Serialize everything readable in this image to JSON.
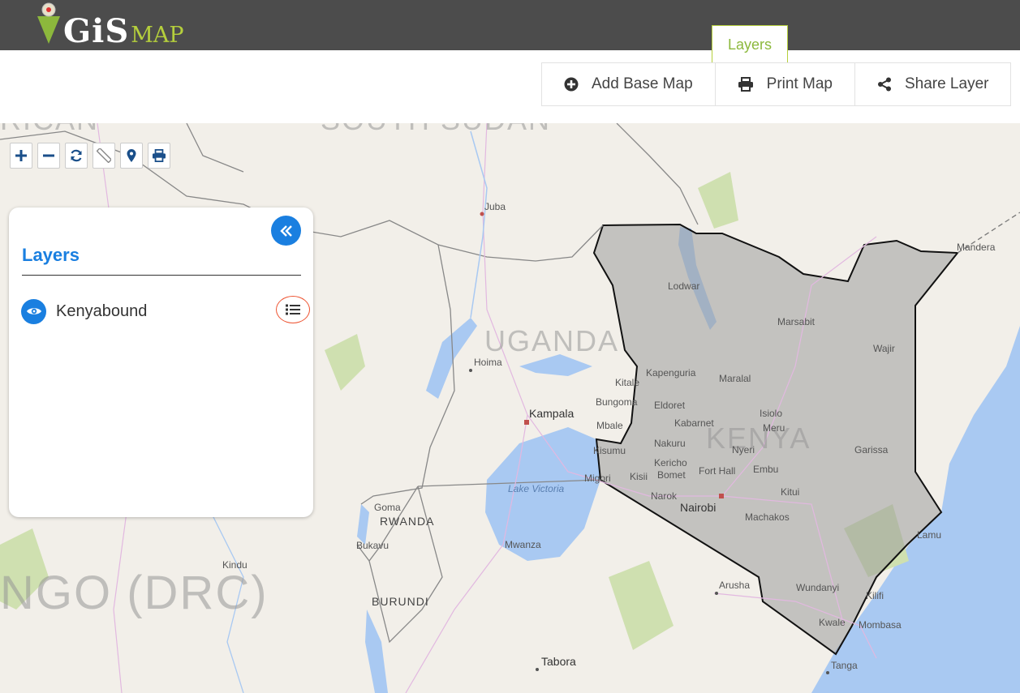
{
  "app": {
    "logo_gis": "GiS",
    "logo_map": "MAP"
  },
  "header": {
    "active_tab": "Layers"
  },
  "toolbar": {
    "add_base_map": "Add Base Map",
    "print_map": "Print Map",
    "share_layer": "Share Layer"
  },
  "map_controls": [
    "plus-icon",
    "minus-icon",
    "refresh-icon",
    "ruler-icon",
    "map-marker-icon",
    "print-icon"
  ],
  "layers_panel": {
    "title": "Layers",
    "items": [
      {
        "name": "Kenyabound",
        "visible": true
      }
    ]
  },
  "map": {
    "countries": {
      "uganda": "UGANDA",
      "kenya": "KENYA",
      "rwanda": "RWANDA",
      "burundi": "BURUNDI",
      "drc": "NGO (DRC)",
      "south_sudan": "SOUTH SUDAN",
      "car": "RICAN"
    },
    "cities": {
      "juba": "Juba",
      "hoima": "Hoima",
      "kampala": "Kampala",
      "mandera": "Mandera",
      "marsabit": "Marsabit",
      "wajir": "Wajir",
      "lodwar": "Lodwar",
      "kapenguria": "Kapenguria",
      "maralal": "Maralal",
      "kitale": "Kitale",
      "bungoma": "Bungoma",
      "eldoret": "Eldoret",
      "mbale": "Mbale",
      "kabarnet": "Kabarnet",
      "isiolo": "Isiolo",
      "meru": "Meru",
      "nakuru": "Nakuru",
      "nyeri": "Nyeri",
      "kisumu": "Kisumu",
      "kericho": "Kericho",
      "garissa": "Garissa",
      "migori": "Migori",
      "kisii": "Kisii",
      "bomet": "Bomet",
      "fort_hall": "Fort Hall",
      "embu": "Embu",
      "narok": "Narok",
      "kitui": "Kitui",
      "nairobi": "Nairobi",
      "machakos": "Machakos",
      "goma": "Goma",
      "bukavu": "Bukavu",
      "mwanza": "Mwanza",
      "lamu": "Lamu",
      "kindu": "Kindu",
      "arusha": "Arusha",
      "wundanyi": "Wundanyi",
      "kilifi": "Kilifi",
      "kwale": "Kwale",
      "mombasa": "Mombasa",
      "tabora": "Tabora",
      "tanga": "Tanga"
    },
    "lakes": {
      "victoria": "Lake Victoria"
    }
  },
  "colors": {
    "accent": "#1a7fe0",
    "brand_green": "#b5cf3c",
    "topbar": "#4c4c4c"
  }
}
